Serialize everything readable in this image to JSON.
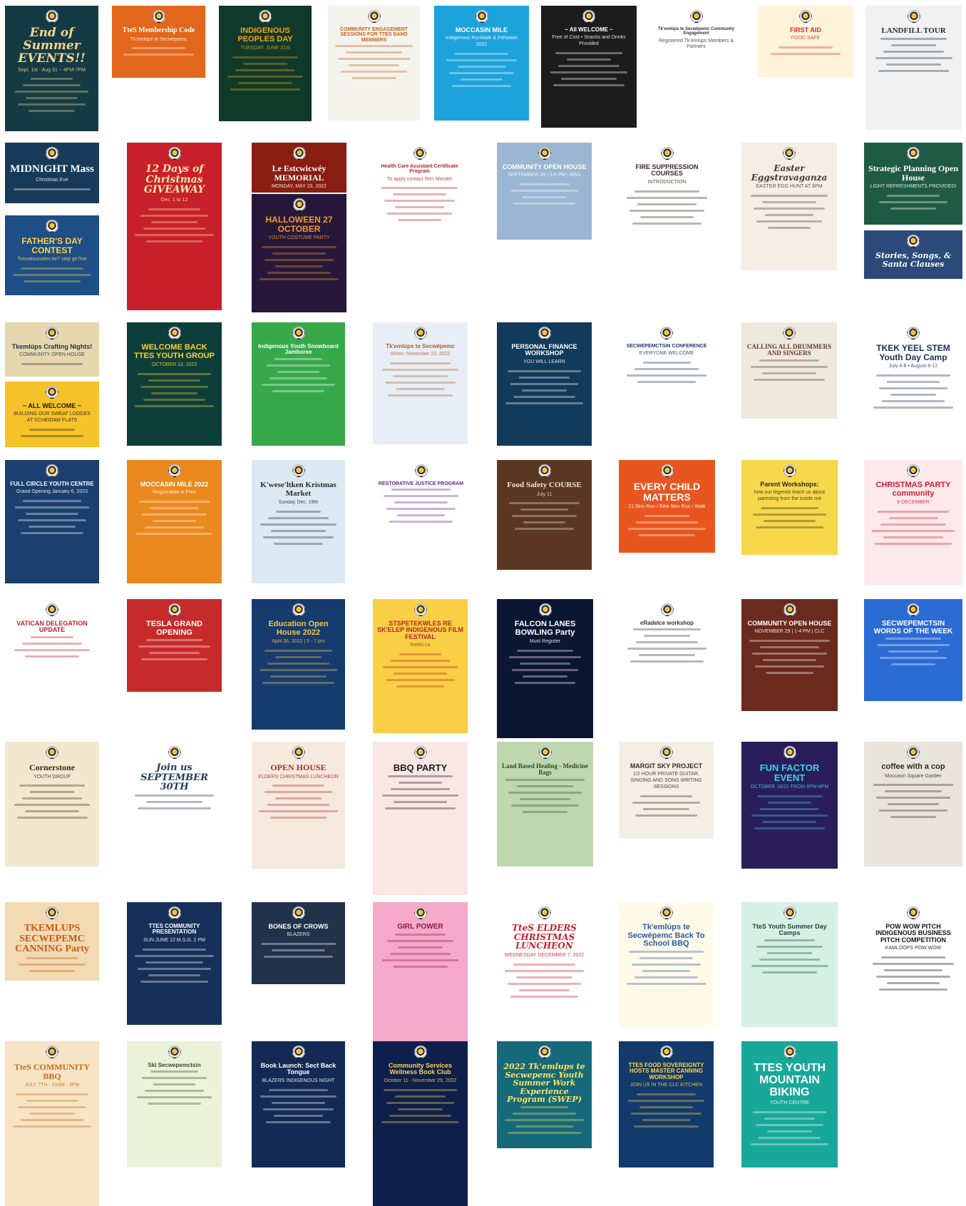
{
  "posters": [
    {
      "heading": "End of Summer EVENTS!!",
      "sub": "Sept. 1st - Aug 31 ~ 4PM-7PM",
      "bg": "#143b44",
      "fg": "#f4d58d",
      "font": "deco",
      "size": 17
    },
    {
      "heading": "TteS Membership Code",
      "sub": "Tk'emlúps te Secwépemc",
      "bg": "#e2661b",
      "fg": "#ffffff",
      "font": "serif",
      "size": 10
    },
    {
      "heading": "INDIGENOUS PEOPLES DAY",
      "sub": "TUESDAY, JUNE 21st",
      "bg": "#0f3a2a",
      "fg": "#f2a21b",
      "font": "sans",
      "size": 11
    },
    {
      "heading": "COMMUNITY ENGAGEMENT SESSIONS FOR TTES BAND MEMBERS",
      "sub": "",
      "bg": "#f5f3ee",
      "fg": "#c8621a",
      "font": "sans",
      "size": 7
    },
    {
      "heading": "MOCCASIN MILE",
      "sub": "Indigenous RunWalk & FitNation 2022",
      "bg": "#1da3dc",
      "fg": "#ffffff",
      "font": "sans",
      "size": 9
    },
    {
      "heading": "~ All WELCOME ~",
      "sub": "Free of Cost • Snacks and Drinks Provided",
      "bg": "#1c1c1c",
      "fg": "#ffffff",
      "font": "sans",
      "size": 8
    },
    {
      "heading": "Tk'emlúps te Secwépemc Community Engagement",
      "sub": "Registered Tk'emlúps Members & Partners",
      "bg": "#ffffff",
      "fg": "#333333",
      "font": "sans",
      "size": 6
    },
    {
      "heading": "FIRST AID",
      "sub": "FOOD SAFE",
      "bg": "#fff3dc",
      "fg": "#d6312a",
      "font": "sans",
      "size": 9
    },
    {
      "heading": "LANDFILL TOUR",
      "sub": "",
      "bg": "#f1f1f1",
      "fg": "#1f2b35",
      "font": "serif",
      "size": 11
    },
    {
      "heading": "MIDNIGHT Mass",
      "sub": "Christmas Eve",
      "bg": "#173a5a",
      "fg": "#ffffff",
      "font": "serif",
      "size": 15
    },
    {
      "heading": "12 Days of Christmas GIVEAWAY",
      "sub": "Dec. 1 to 12",
      "bg": "#c8202a",
      "fg": "#ffe9a8",
      "font": "deco",
      "size": 14
    },
    {
      "heading": "Le Estcwicwéy MEMORIAL",
      "sub": "MONDAY, MAY 23, 2022",
      "bg": "#8a1d12",
      "fg": "#ffffff",
      "font": "serif",
      "size": 12
    },
    {
      "heading": "Health Care Assistant Certificate Program",
      "sub": "To apply contact Terri Mendel",
      "bg": "#ffffff",
      "fg": "#b8262a",
      "font": "sans",
      "size": 7
    },
    {
      "heading": "COMMUNITY OPEN HOUSE",
      "sub": "SEPTEMBER 29 | 3-6 PM | MSG",
      "bg": "#9ab6d2",
      "fg": "#ffffff",
      "font": "sans",
      "size": 9
    },
    {
      "heading": "FIRE SUPPRESSION COURSES",
      "sub": "INTRODUCTION",
      "bg": "#ffffff",
      "fg": "#3a2b27",
      "font": "sans",
      "size": 9
    },
    {
      "heading": "Easter Eggstravaganza",
      "sub": "EASTER EGG HUNT AT 6PM",
      "bg": "#f4eee6",
      "fg": "#4c3a2e",
      "font": "deco",
      "size": 12
    },
    {
      "heading": "Strategic Planning Open House",
      "sub": "LIGHT REFRESHMENTS PROVIDED!",
      "bg": "#1f5a44",
      "fg": "#ffffff",
      "font": "serif",
      "size": 12
    },
    {
      "heading": "FATHER'S DAY CONTEST",
      "sub": "Tsecwtsucwtes ke7 sitqt ge7tse",
      "bg": "#1d4e86",
      "fg": "#ffd04a",
      "font": "sans",
      "size": 12
    },
    {
      "heading": "HALLOWEEN 27 OCTOBER",
      "sub": "YOUTH COSTUME PARTY",
      "bg": "#27183b",
      "fg": "#f49b28",
      "font": "sans",
      "size": 12
    },
    {
      "heading": "Stories, Songs, & Santa Clauses",
      "sub": "",
      "bg": "#2b4a7a",
      "fg": "#ffffff",
      "font": "deco",
      "size": 11
    },
    {
      "heading": "Tkemlúps Crafting Nights!",
      "sub": "COMMUNITY OPEN HOUSE",
      "bg": "#e6d7ae",
      "fg": "#1e3348",
      "font": "sans",
      "size": 9
    },
    {
      "heading": "WELCOME BACK TTES YOUTH GROUP",
      "sub": "OCTOBER 12, 2022",
      "bg": "#0d3e3a",
      "fg": "#ffd12a",
      "font": "sans",
      "size": 11
    },
    {
      "heading": "Indigenous Youth Snowboard Jamboree",
      "sub": "",
      "bg": "#37a94b",
      "fg": "#ffffff",
      "font": "sans",
      "size": 8
    },
    {
      "heading": "Tk'emlúps te Secwépemc",
      "sub": "When: November 10, 2022",
      "bg": "#e7eef6",
      "fg": "#b0602a",
      "font": "sans",
      "size": 8
    },
    {
      "heading": "PERSONAL FINANCE WORKSHOP",
      "sub": "YOU WILL LEARN",
      "bg": "#123a5a",
      "fg": "#ffffff",
      "font": "sans",
      "size": 9
    },
    {
      "heading": "SECWEPEMCTSIN CONFERENCE",
      "sub": "EVERYONE WELCOME",
      "bg": "#ffffff",
      "fg": "#1d3a6a",
      "font": "sans",
      "size": 7
    },
    {
      "heading": "CALLING ALL DRUMMERS AND SINGERS",
      "sub": "",
      "bg": "#efe8dc",
      "fg": "#5a3e2a",
      "font": "serif",
      "size": 9
    },
    {
      "heading": "TKEK YEEL STEM Youth Day Camp",
      "sub": "July 4-8 • August 8-12",
      "bg": "#ffffff",
      "fg": "#1b2f5b",
      "font": "sans",
      "size": 12
    },
    {
      "heading": "~ ALL WELCOME ~",
      "sub": "BUILDING OUR SWEAT LODGES AT SCHEIDAM FLATS",
      "bg": "#f6c22a",
      "fg": "#1f1a12",
      "font": "sans",
      "size": 9
    },
    {
      "heading": "FULL CIRCLE YOUTH CENTRE",
      "sub": "Grand Opening January 6, 2023",
      "bg": "#1b3f6e",
      "fg": "#ffffff",
      "font": "sans",
      "size": 8
    },
    {
      "heading": "MOCCASIN MILE 2022",
      "sub": "Registration is Free",
      "bg": "#e9891e",
      "fg": "#ffffff",
      "font": "sans",
      "size": 9
    },
    {
      "heading": "K'wese'ltken Kristmas Market",
      "sub": "Sunday Dec. 18th",
      "bg": "#dbe9f3",
      "fg": "#2b2b2b",
      "font": "serif",
      "size": 11
    },
    {
      "heading": "RESTORATIVE JUSTICE PROGRAM",
      "sub": "",
      "bg": "#ffffff",
      "fg": "#5a2a8a",
      "font": "sans",
      "size": 7
    },
    {
      "heading": "Food Safety COURSE",
      "sub": "July 11",
      "bg": "#5a3722",
      "fg": "#f2e6d6",
      "font": "serif",
      "size": 11
    },
    {
      "heading": "EVERY CHILD MATTERS",
      "sub": "21.5km Run / Bike 5km Run / Walk",
      "bg": "#e8561f",
      "fg": "#ffffff",
      "font": "sans",
      "size": 14
    },
    {
      "heading": "Parent Workshops:",
      "sub": "how our legends teach us about parenting from the inside out",
      "bg": "#f6d84a",
      "fg": "#2a2a2a",
      "font": "sans",
      "size": 9
    },
    {
      "heading": "CHRISTMAS PARTY community",
      "sub": "8 DECEMBER",
      "bg": "#fde9ec",
      "fg": "#c82234",
      "font": "sans",
      "size": 11
    },
    {
      "heading": "VATICAN DELEGATION UPDATE",
      "sub": "",
      "bg": "#ffffff",
      "fg": "#c3212a",
      "font": "sans",
      "size": 9
    },
    {
      "heading": "TESLA GRAND OPENING",
      "sub": "",
      "bg": "#c72a2a",
      "fg": "#ffffff",
      "font": "sans",
      "size": 11
    },
    {
      "heading": "Education Open House 2022",
      "sub": "April 26, 2022 | 5 - 7 pm",
      "bg": "#163b6e",
      "fg": "#f7c64a",
      "font": "sans",
      "size": 11
    },
    {
      "heading": "STSPETEKWLES RE SK'ELEP INDIGENOUS FILM FESTIVAL",
      "sub": "thekfs.ca",
      "bg": "#f9cf45",
      "fg": "#b5242c",
      "font": "sans",
      "size": 9
    },
    {
      "heading": "FALCON LANES BOWLING Party",
      "sub": "Must Register",
      "bg": "#0b1633",
      "fg": "#ffffff",
      "font": "sans",
      "size": 11
    },
    {
      "heading": "eRadelce workshop",
      "sub": "",
      "bg": "#ffffff",
      "fg": "#333333",
      "font": "sans",
      "size": 8
    },
    {
      "heading": "COMMUNITY OPEN HOUSE",
      "sub": "NOVEMBER 29 | 1-4 PM | CLC",
      "bg": "#6a2a1d",
      "fg": "#ffffff",
      "font": "sans",
      "size": 9
    },
    {
      "heading": "SECWEPEMCTSIN WORDS OF THE WEEK",
      "sub": "",
      "bg": "#2b6bd4",
      "fg": "#ffffff",
      "font": "sans",
      "size": 10
    },
    {
      "heading": "Cornerstone",
      "sub": "YOUTH GROUP",
      "bg": "#f4e7cf",
      "fg": "#3a2a1a",
      "font": "serif",
      "size": 12
    },
    {
      "heading": "Join us SEPTEMBER 30TH",
      "sub": "",
      "bg": "#ffffff",
      "fg": "#1f3a5a",
      "font": "deco",
      "size": 13
    },
    {
      "heading": "OPEN HOUSE",
      "sub": "ELDERS CHRISTMAS LUNCHEON",
      "bg": "#f6e9de",
      "fg": "#b02a2a",
      "font": "serif",
      "size": 12
    },
    {
      "heading": "BBQ PARTY",
      "sub": "",
      "bg": "#fbe6e6",
      "fg": "#1d1d1d",
      "font": "sans",
      "size": 13
    },
    {
      "heading": "Land Based Healing - Medicine Bags",
      "sub": "",
      "bg": "#bfd7ae",
      "fg": "#2f4a2a",
      "font": "serif",
      "size": 9
    },
    {
      "heading": "MARGIT SKY PROJECT",
      "sub": "1/2 HOUR PRIVATE GUITAR, SINGING AND SONG WRITING SESSIONS",
      "bg": "#f4efe4",
      "fg": "#3a2a22",
      "font": "sans",
      "size": 9
    },
    {
      "heading": "FUN FACTOR EVENT",
      "sub": "OCTOBER 18/22 FROM 6PM-8PM",
      "bg": "#2a1d5a",
      "fg": "#39d6e6",
      "font": "sans",
      "size": 13
    },
    {
      "heading": "coffee with a cop",
      "sub": "Moccasin Square Garden",
      "bg": "#e8e4dc",
      "fg": "#2a2a2a",
      "font": "sans",
      "size": 11
    },
    {
      "heading": "TKEMLUPS SECWEPEMC CANNING Party",
      "sub": "",
      "bg": "#f2dab3",
      "fg": "#c95a15",
      "font": "serif",
      "size": 14
    },
    {
      "heading": "TTES COMMUNITY PRESENTATION",
      "sub": "SUN JUNE 12 M.S.G. 2 PM",
      "bg": "#17305a",
      "fg": "#ffffff",
      "font": "sans",
      "size": 8
    },
    {
      "heading": "BONES OF CROWS",
      "sub": "BLAZERS",
      "bg": "#21324a",
      "fg": "#ffffff",
      "font": "sans",
      "size": 9
    },
    {
      "heading": "GIRL POWER",
      "sub": "",
      "bg": "#f6a8c8",
      "fg": "#8a1d4a",
      "font": "sans",
      "size": 10
    },
    {
      "heading": "TteS ELDERS CHRISTMAS LUNCHEON",
      "sub": "WEDNESDAY DECEMBER 7, 2022",
      "bg": "#ffffff",
      "fg": "#c8202a",
      "font": "deco",
      "size": 12
    },
    {
      "heading": "Tk'emlúps te Secwépemc Back To School BBQ",
      "sub": "",
      "bg": "#fffbe8",
      "fg": "#2a5aa8",
      "font": "sans",
      "size": 11
    },
    {
      "heading": "TteS Youth Summer Day Camps",
      "sub": "",
      "bg": "#d7f0e6",
      "fg": "#1d4a3a",
      "font": "sans",
      "size": 9
    },
    {
      "heading": "POW WOW PITCH INDIGENOUS BUSINESS PITCH COMPETITION",
      "sub": "KAMLOOPS POW WOW",
      "bg": "#ffffff",
      "fg": "#111111",
      "font": "sans",
      "size": 9
    },
    {
      "heading": "TteS COMMUNITY BBQ",
      "sub": "JULY 7TH - 10AM - 3PM",
      "bg": "#f7e4c4",
      "fg": "#c86a1a",
      "font": "serif",
      "size": 12
    },
    {
      "heading": "Ski Secwepemctsin",
      "sub": "",
      "bg": "#eaf2d9",
      "fg": "#3a4a2a",
      "font": "sans",
      "size": 8
    },
    {
      "heading": "Book Launch: Sect Back Tongue",
      "sub": "BLAZERS INDIGENOUS NIGHT",
      "bg": "#132a55",
      "fg": "#ffffff",
      "font": "sans",
      "size": 9
    },
    {
      "heading": "Community Services Wellness Book Club",
      "sub": "October 11 - November 29, 2022",
      "bg": "#0d1f4a",
      "fg": "#ffd34a",
      "font": "sans",
      "size": 9
    },
    {
      "heading": "2022 Tk'emlups te Secwepemc Youth Summer Work Experience Program (SWEP)",
      "sub": "",
      "bg": "#15697a",
      "fg": "#ffe45a",
      "font": "deco",
      "size": 11
    },
    {
      "heading": "TTES FOOD SOVEREIGNTY HOSTS MASTER CANNING WORKSHOP",
      "sub": "JOIN US IN THE CLC KITCHEN",
      "bg": "#123a6a",
      "fg": "#ffd34a",
      "font": "sans",
      "size": 8
    },
    {
      "heading": "TTES YOUTH MOUNTAIN BIKING",
      "sub": "YOUTH CENTRE",
      "bg": "#18a89a",
      "fg": "#ffffff",
      "font": "sans",
      "size": 16
    }
  ]
}
